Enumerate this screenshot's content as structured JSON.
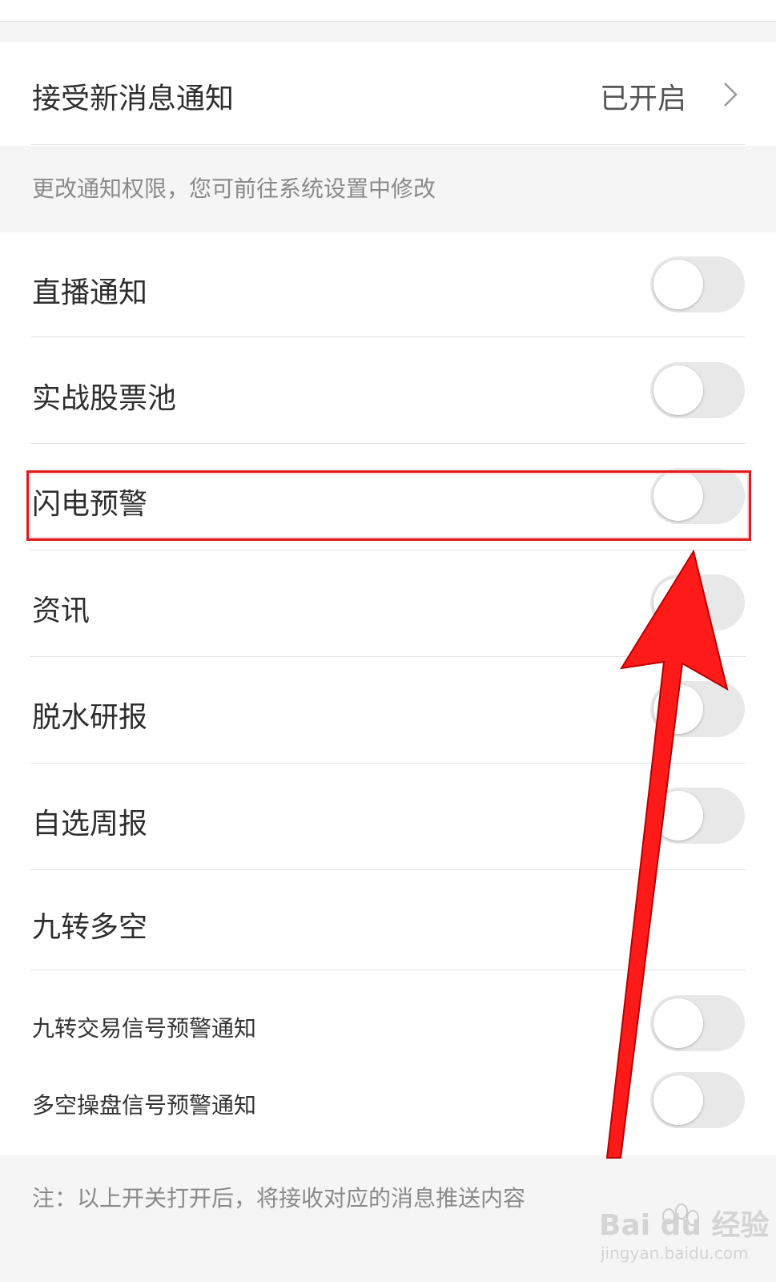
{
  "notify": {
    "label": "接受新消息通知",
    "status": "已开启"
  },
  "permission_note": "更改通知权限，您可前往系统设置中修改",
  "items": [
    {
      "label": "直播通知",
      "on": false
    },
    {
      "label": "实战股票池",
      "on": false
    },
    {
      "label": "闪电预警",
      "on": false
    },
    {
      "label": "资讯",
      "on": false
    },
    {
      "label": "脱水研报",
      "on": false
    },
    {
      "label": "自选周报",
      "on": false
    }
  ],
  "section": {
    "title": "九转多空",
    "subitems": [
      {
        "label": "九转交易信号预警通知",
        "on": false
      },
      {
        "label": "多空操盘信号预警通知",
        "on": false
      }
    ]
  },
  "footer_note": "注：以上开关打开后，将接收对应的消息推送内容",
  "watermark": {
    "logo": "Bai du 经验",
    "url": "jingyan.baidu.com"
  },
  "colors": {
    "toggle_off": "#e8e8e8",
    "highlight": "#e01b1b",
    "arrow": "#ff1a1a"
  }
}
